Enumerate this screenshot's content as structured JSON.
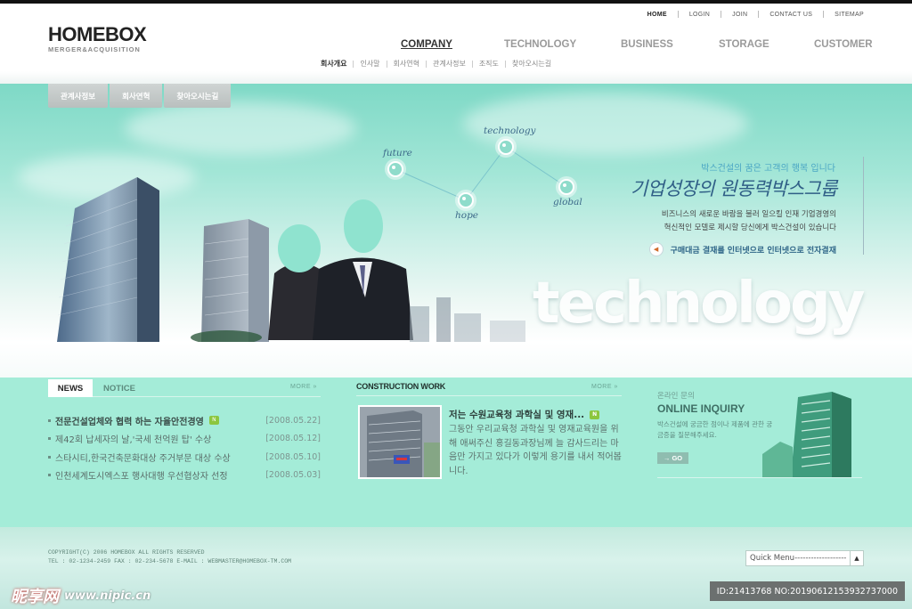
{
  "header": {
    "logo_main": "HOMEBOX",
    "logo_sub": "MERGER&ACQUISITION",
    "util_links": [
      "HOME",
      "LOGIN",
      "JOIN",
      "CONTACT US",
      "SITEMAP"
    ],
    "gnb": [
      "COMPANY",
      "TECHNOLOGY",
      "BUSINESS",
      "STORAGE",
      "CUSTOMER"
    ],
    "gnb_active": "COMPANY",
    "snb": [
      "회사개요",
      "인사말",
      "회사연혁",
      "관계사정보",
      "조직도",
      "찾아오시는길"
    ]
  },
  "hero": {
    "subtabs": [
      "관계사정보",
      "회사연혁",
      "찾아오시는길"
    ],
    "nodes": [
      "future",
      "technology",
      "hope",
      "global"
    ],
    "tagline": "박스건설의 꿈은 고객의 행복 입니다",
    "headline": "기업성장의 원동력박스그룹",
    "desc_lines": [
      "비즈니스의 새로운 바람을 불러 일으킬 인재 기업경영의",
      "혁신적인 모델로 제시할 당신에게 박스건설이 있습니다"
    ],
    "paylink": "구매대금 결재를 인터넷으로 인터넷으로 전자결재",
    "bigword": "technology"
  },
  "news": {
    "tabs": [
      "NEWS",
      "NOTICE"
    ],
    "more": "MORE »",
    "items": [
      {
        "title": "전문건설업체와 협력 하는 자율안전경영",
        "date": "[2008.05.22]",
        "is_new": true
      },
      {
        "title": "제42회 납세자의 날,'국세 천억원 탑' 수상",
        "date": "[2008.05.12]",
        "is_new": false
      },
      {
        "title": "스타시티,한국건축문화대상 주거부문 대상 수상",
        "date": "[2008.05.10]",
        "is_new": false
      },
      {
        "title": "인천세계도시엑스포 행사대행 우선협상자 선정",
        "date": "[2008.05.03]",
        "is_new": false
      }
    ],
    "new_badge": "N"
  },
  "construction": {
    "heading": "CONSTRUCTION WORK",
    "more": "MORE »",
    "title": "저는 수원교육청 과학실 및 영재...",
    "text": "그동안 우리교육청 과학실 및 영재교육원을 위해 애써주신 홍길동과장님께 늘 감사드리는 마음만 가지고 있다가 이렇게 용기를 내서 적어봅니다."
  },
  "inquiry": {
    "kr": "온라인 문의",
    "en": "ONLINE INQUIRY",
    "desc": "박스건설에 궁금한 점이나 제품에 관한 궁금증을 질문해주세요.",
    "go": "→ GO"
  },
  "footer": {
    "copyright": "COPYRIGHT(C) 2006 HOMEBOX ALL RIGHTS RESERVED",
    "contact": "TEL : 02-1234-2459 FAX : 02-234-5678   E-MAIL : WEBMASTER@HOMEBOX-TM.COM",
    "quick_menu": "Quick Menu-------------------"
  },
  "watermark": {
    "brand": "昵享网",
    "url": "www.nipic.cn",
    "id": "ID:21413768 NO:20190612153932737000"
  },
  "colors": {
    "mint": "#a4ecd8",
    "hero_top": "#7ed9c6",
    "headline": "#2f5e86",
    "new_badge": "#8cc63f"
  }
}
